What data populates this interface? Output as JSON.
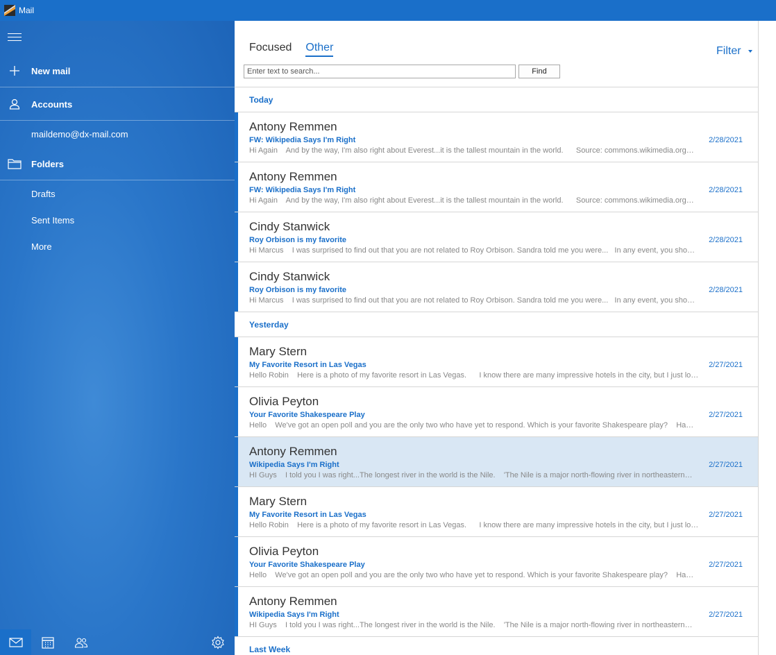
{
  "app": {
    "title": "Mail"
  },
  "sidebar": {
    "new_mail": "New mail",
    "accounts": "Accounts",
    "account_email": "maildemo@dx-mail.com",
    "folders": "Folders",
    "folder_items": [
      "Drafts",
      "Sent Items",
      "More"
    ]
  },
  "main": {
    "tabs": [
      {
        "label": "Focused",
        "active": false
      },
      {
        "label": "Other",
        "active": true
      }
    ],
    "filter_label": "Filter",
    "search_placeholder": "Enter text to search...",
    "find_label": "Find"
  },
  "groups": [
    {
      "header": "Today",
      "messages": [
        {
          "sender": "Antony Remmen",
          "subject": "FW: Wikipedia Says I'm Right",
          "date": "2/28/2021",
          "preview": "Hi Again    And by the way, I'm also right about Everest...it is the tallest mountain in the world.      Source: commons.wikimedia.org…",
          "selected": false
        },
        {
          "sender": "Antony Remmen",
          "subject": "FW: Wikipedia Says I'm Right",
          "date": "2/28/2021",
          "preview": "Hi Again    And by the way, I'm also right about Everest...it is the tallest mountain in the world.      Source: commons.wikimedia.org…",
          "selected": false
        },
        {
          "sender": "Cindy Stanwick",
          "subject": "Roy Orbison is my favorite",
          "date": "2/28/2021",
          "preview": "Hi Marcus    I was surprised to find out that you are not related to Roy Orbison. Sandra told me you were...   In any event, you sho…",
          "selected": false
        },
        {
          "sender": "Cindy Stanwick",
          "subject": "Roy Orbison is my favorite",
          "date": "2/28/2021",
          "preview": "Hi Marcus    I was surprised to find out that you are not related to Roy Orbison. Sandra told me you were...   In any event, you sho…",
          "selected": false
        }
      ]
    },
    {
      "header": "Yesterday",
      "messages": [
        {
          "sender": "Mary Stern",
          "subject": "My Favorite Resort in Las Vegas",
          "date": "2/27/2021",
          "preview": "Hello Robin    Here is a photo of my favorite resort in Las Vegas.      I know there are many impressive hotels in the city, but I just lo…",
          "selected": false
        },
        {
          "sender": "Olivia Peyton",
          "subject": "Your Favorite Shakespeare Play",
          "date": "2/27/2021",
          "preview": "Hello    We've got an open poll and you are the only two who have yet to respond. Which is your favorite Shakespeare play?    Ha…",
          "selected": false
        },
        {
          "sender": "Antony Remmen",
          "subject": "Wikipedia Says I'm Right",
          "date": "2/27/2021",
          "preview": "HI Guys    I told you I was right...The longest river in the world is the Nile.    'The Nile is a major north-flowing river in northeastern…",
          "selected": true
        },
        {
          "sender": "Mary Stern",
          "subject": "My Favorite Resort in Las Vegas",
          "date": "2/27/2021",
          "preview": "Hello Robin    Here is a photo of my favorite resort in Las Vegas.      I know there are many impressive hotels in the city, but I just lo…",
          "selected": false
        },
        {
          "sender": "Olivia Peyton",
          "subject": "Your Favorite Shakespeare Play",
          "date": "2/27/2021",
          "preview": "Hello    We've got an open poll and you are the only two who have yet to respond. Which is your favorite Shakespeare play?    Ha…",
          "selected": false
        },
        {
          "sender": "Antony Remmen",
          "subject": "Wikipedia Says I'm Right",
          "date": "2/27/2021",
          "preview": "HI Guys    I told you I was right...The longest river in the world is the Nile.    'The Nile is a major north-flowing river in northeastern…",
          "selected": false
        }
      ]
    },
    {
      "header": "Last Week",
      "messages": []
    }
  ],
  "icons": {
    "menu": "hamburger-icon",
    "new_mail": "plus-icon",
    "accounts": "person-icon",
    "folders": "folder-icon",
    "mail": "mail-icon",
    "calendar": "calendar-icon",
    "people": "people-icon",
    "settings": "gear-icon"
  },
  "colors": {
    "accent": "#1a6fc9",
    "selected_row": "#d9e7f4"
  }
}
